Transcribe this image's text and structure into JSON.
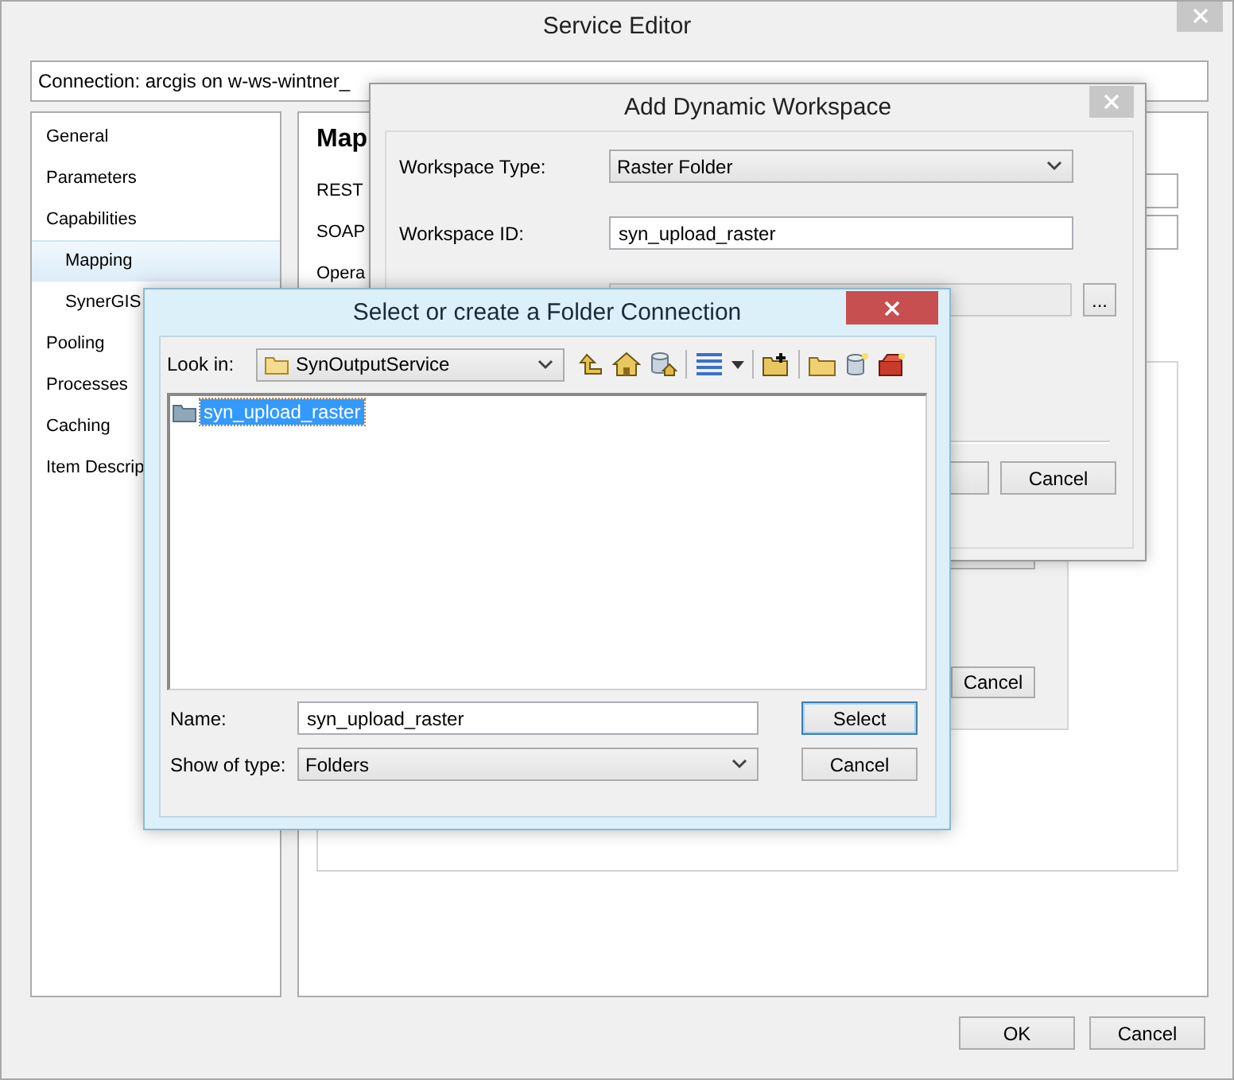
{
  "window": {
    "title": "Service Editor"
  },
  "connection": "Connection: arcgis on w-ws-wintner_",
  "sidebar": {
    "items": [
      {
        "label": "General",
        "selected": false
      },
      {
        "label": "Parameters",
        "selected": false
      },
      {
        "label": "Capabilities",
        "selected": false,
        "children": [
          {
            "label": "Mapping",
            "selected": true
          },
          {
            "label": "SynerGIS",
            "selected": false
          }
        ]
      },
      {
        "label": "Pooling",
        "selected": false
      },
      {
        "label": "Processes",
        "selected": false
      },
      {
        "label": "Caching",
        "selected": false
      },
      {
        "label": "Item Descrip",
        "selected": false
      }
    ]
  },
  "panel": {
    "heading": "Map",
    "rows": [
      {
        "label": "REST",
        "kind": "field"
      },
      {
        "label": "SOAP",
        "kind": "field"
      },
      {
        "label": "Opera",
        "kind": "text"
      }
    ],
    "inner_buttons": [
      "Cancel"
    ]
  },
  "buttons": [
    "OK",
    "Cancel"
  ],
  "workspace_dialog": {
    "title": "Add Dynamic Workspace",
    "workspace_type": {
      "label": "Workspace Type:",
      "value": "Raster Folder"
    },
    "workspace_id": {
      "label": "Workspace ID:",
      "value": "syn_upload_raster"
    },
    "browse_button": "...",
    "buttons": [
      "Cancel"
    ]
  },
  "folder_dialog": {
    "title": "Select or create a Folder Connection",
    "look_in": {
      "label": "Look in:",
      "value": "SynOutputService"
    },
    "items": [
      {
        "label": "syn_upload_raster",
        "selected": true
      }
    ],
    "name": {
      "label": "Name:",
      "value": "syn_upload_raster"
    },
    "type": {
      "label": "Show of type:",
      "value": "Folders"
    },
    "buttons": [
      {
        "label": "Select",
        "default": true
      },
      {
        "label": "Cancel",
        "default": false
      }
    ]
  }
}
